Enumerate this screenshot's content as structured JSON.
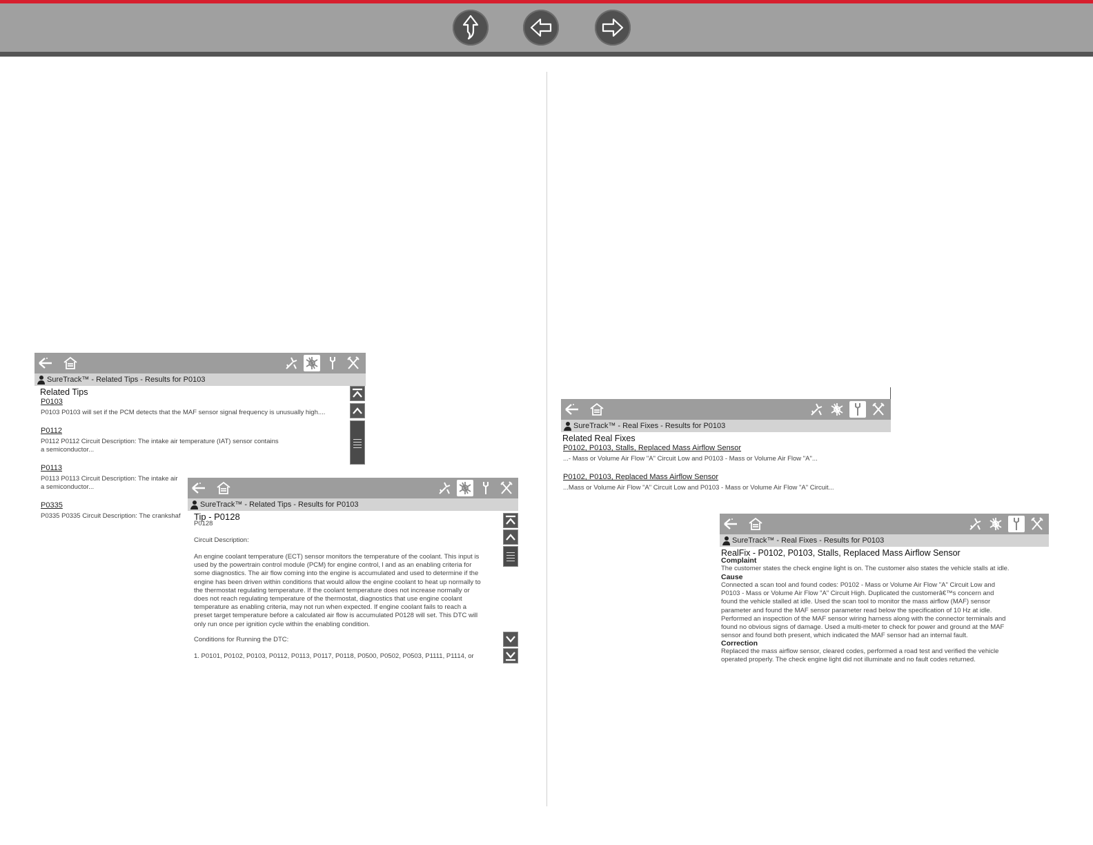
{
  "nav": {
    "up_icon": "up-arrow-icon",
    "back_icon": "left-arrow-icon",
    "forward_icon": "right-arrow-icon",
    "accent": "#d71f2e"
  },
  "win1": {
    "title": "SureTrack™ - Related Tips - Results for P0103",
    "heading": "Related Tips",
    "items": [
      {
        "code": "P0103",
        "desc1": "P0103 P0103 will set if the PCM detects that the MAF sensor signal frequency is unusually high....",
        "desc2": ""
      },
      {
        "code": "P0112",
        "desc1": "P0112 P0112 Circuit Description: The intake air temperature (IAT) sensor contains",
        "desc2": "a semiconductor..."
      },
      {
        "code": "P0113",
        "desc1": "P0113 P0113 Circuit Description: The intake air",
        "desc2": "a semiconductor..."
      },
      {
        "code": "P0335",
        "desc1": "P0335 P0335 Circuit Description: The crankshaf",
        "desc2": ""
      }
    ]
  },
  "win2": {
    "title": "SureTrack™ - Related Tips - Results for P0103",
    "heading": "Tip - P0128",
    "sub": "P0128",
    "section1": "Circuit Description:",
    "lines": [
      "An engine coolant temperature (ECT) sensor monitors the temperature of the coolant. This input is",
      "used by the powertrain control module (PCM) for engine control, l and as an enabling criteria for",
      "some diagnostics.  The air flow coming into the engine is accumulated and used to determine if the",
      "engine has been driven within conditions that would allow the engine coolant to heat up normally to",
      "the thermostat regulating temperature. If the coolant temperature does not increase normally or",
      "does not reach regulating temperature of the thermostat, diagnostics that use engine coolant",
      "temperature as enabling criteria, may not run when expected.  If engine coolant fails to reach a",
      "preset target temperature before a calculated air flow is accumulated P0128 will set.  This DTC will",
      "only run once per ignition cycle within the enabling condition."
    ],
    "section2": "Conditions for Running the DTC:",
    "list1": "1.   P0101, P0102, P0103, P0112, P0113, P0117, P0118, P0500, P0502, P0503, P1111, P1114, or"
  },
  "win3": {
    "title": "SureTrack™ - Real Fixes - Results for P0103",
    "heading": "Related Real Fixes",
    "items": [
      {
        "link": "P0102, P0103, Stalls, Replaced Mass Airflow Sensor",
        "desc": "...- Mass or Volume Air Flow \"A\" Circuit Low and P0103 - Mass or Volume Air Flow \"A\"..."
      },
      {
        "link": "P0102, P0103, Replaced Mass Airflow Sensor",
        "desc": "...Mass or Volume Air Flow \"A\" Circuit Low and P0103 - Mass or Volume Air Flow \"A\" Circuit..."
      }
    ]
  },
  "win4": {
    "title": "SureTrack™ - Real Fixes - Results for P0103",
    "heading": "RealFix - P0102, P0103, Stalls, Replaced Mass Airflow Sensor",
    "complaint_label": "Complaint",
    "complaint": "The customer states the check engine light is on. The customer also states the vehicle stalls at idle.",
    "cause_label": "Cause",
    "cause": [
      "Connected a scan tool and found codes: P0102 - Mass or Volume Air Flow \"A\" Circuit Low and",
      "P0103 - Mass or Volume Air Flow \"A\" Circuit High. Duplicated the customerâ€™s concern and",
      "found the vehicle stalled at idle. Used the scan tool to monitor the mass airflow (MAF) sensor",
      "parameter and found the MAF sensor parameter read below the specification of 10 Hz at idle.",
      "Performed an inspection of the MAF sensor wiring harness along with the connector terminals and",
      "found no obvious signs of damage. Used a multi-meter to check for power and ground at the MAF",
      "sensor and found both present, which indicated the MAF sensor had an internal fault."
    ],
    "correction_label": "Correction",
    "correction": [
      "Replaced the mass airflow sensor, cleared codes, performed a road test and verified the vehicle",
      "operated properly. The check engine light did not illuminate and no fault codes returned."
    ]
  }
}
